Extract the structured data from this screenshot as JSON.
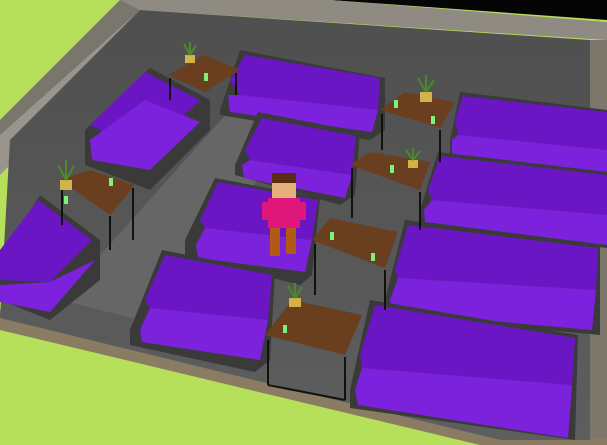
{
  "scene": {
    "kind": "isometric-lounge-room",
    "colors": {
      "floor": "#5a5a5a",
      "wall": "#8c8a85",
      "wall_top": "#6f6a60",
      "sofa_base": "#3a3a3a",
      "sofa_cushion": "#6a16c4",
      "sofa_cushion_light": "#7d22dc",
      "table_top": "#6a3f1f",
      "table_leg": "#1a1a1a",
      "glass": "#7cf27a",
      "plant": "#4a8a2a",
      "pot": "#d4b24a",
      "character_shirt": "#e0177a",
      "character_hair": "#5a2e12",
      "character_skin": "#e6b07a",
      "character_pants": "#b05a14",
      "grass": "#b6df5a"
    },
    "objects": {
      "sofas": 12,
      "tables": 6,
      "plants": 5,
      "glasses": 12,
      "characters": 1
    }
  }
}
